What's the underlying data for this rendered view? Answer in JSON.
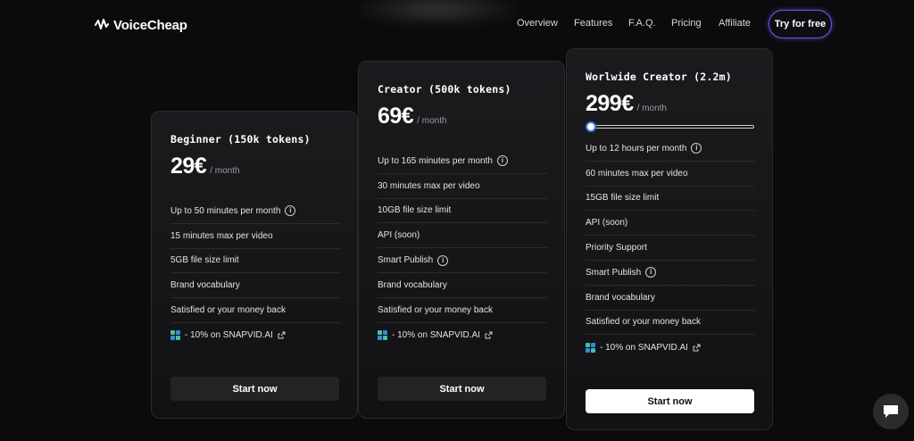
{
  "brand": {
    "name": "VoiceCheap"
  },
  "nav": {
    "links": [
      "Overview",
      "Features",
      "F.A.Q.",
      "Pricing",
      "Affiliate"
    ],
    "cta": "Try for free"
  },
  "plans": [
    {
      "title": "Beginner (150k tokens)",
      "price": "29€",
      "period": "/ month",
      "features": [
        {
          "text": "Up to 50 minutes per month",
          "info": true
        },
        {
          "text": "15 minutes max per video",
          "info": false
        },
        {
          "text": "5GB file size limit",
          "info": false
        },
        {
          "text": "Brand vocabulary",
          "info": false
        },
        {
          "text": "Satisfied or your money back",
          "info": false
        }
      ],
      "promo": "- 10% on SNAPVID.AI",
      "button": "Start now"
    },
    {
      "title": "Creator (500k tokens)",
      "price": "69€",
      "period": "/ month",
      "features": [
        {
          "text": "Up to 165 minutes per month",
          "info": true
        },
        {
          "text": "30 minutes max per video",
          "info": false
        },
        {
          "text": "10GB file size limit",
          "info": false
        },
        {
          "text": "API (soon)",
          "info": false
        },
        {
          "text": "Smart Publish",
          "info": true
        },
        {
          "text": "Brand vocabulary",
          "info": false
        },
        {
          "text": "Satisfied or your money back",
          "info": false
        }
      ],
      "promo": "- 10% on SNAPVID.AI",
      "button": "Start now"
    },
    {
      "title": "Worlwide Creator (2.2m)",
      "price": "299€",
      "period": "/ month",
      "slider_value": 0,
      "features": [
        {
          "text": "Up to 12 hours per month",
          "info": true
        },
        {
          "text": "60 minutes max per video",
          "info": false
        },
        {
          "text": "15GB file size limit",
          "info": false
        },
        {
          "text": "API (soon)",
          "info": false
        },
        {
          "text": "Priority Support",
          "info": false
        },
        {
          "text": "Smart Publish",
          "info": true
        },
        {
          "text": "Brand vocabulary",
          "info": false
        },
        {
          "text": "Satisfied or your money back",
          "info": false
        }
      ],
      "promo": "- 10% on SNAPVID.AI",
      "button": "Start now"
    }
  ],
  "icons": {
    "info": "info-circle-icon",
    "promo": "snapvid-logo-icon",
    "external": "external-link-icon",
    "chat": "chat-bubble-icon"
  },
  "colors": {
    "accent": "#6a5ae8",
    "background": "#0b0b0c",
    "card": "#1b1b1e"
  }
}
